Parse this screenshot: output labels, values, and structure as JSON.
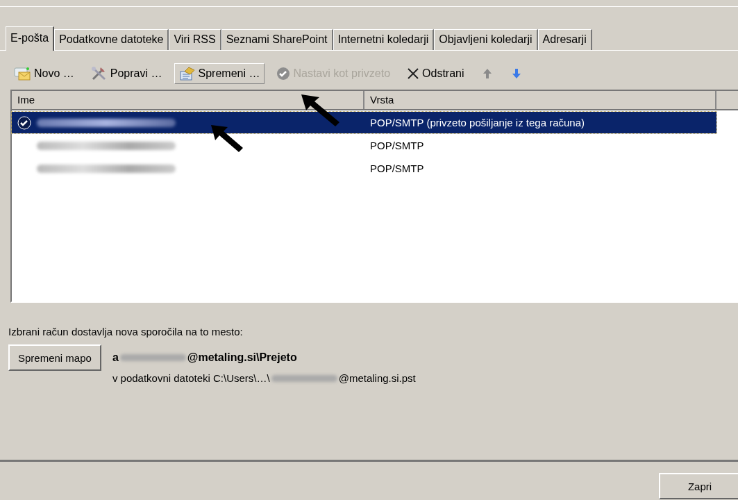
{
  "tabs": [
    {
      "label": "E-pošta",
      "selected": true
    },
    {
      "label": "Podatkovne datoteke",
      "selected": false
    },
    {
      "label": "Viri RSS",
      "selected": false
    },
    {
      "label": "Seznami SharePoint",
      "selected": false
    },
    {
      "label": "Internetni koledarji",
      "selected": false
    },
    {
      "label": "Objavljeni koledarji",
      "selected": false
    },
    {
      "label": "Adresarji",
      "selected": false
    }
  ],
  "toolbar": [
    {
      "kind": "new",
      "label": "Novo …",
      "disabled": false,
      "hovered": false
    },
    {
      "kind": "repair",
      "label": "Popravi …",
      "disabled": false,
      "hovered": false
    },
    {
      "kind": "change",
      "label": "Spremeni …",
      "disabled": false,
      "hovered": true
    },
    {
      "kind": "default",
      "label": "Nastavi kot privzeto",
      "disabled": true,
      "hovered": false
    },
    {
      "kind": "remove",
      "label": "Odstrani",
      "disabled": false,
      "hovered": false
    },
    {
      "kind": "up",
      "disabled": true,
      "hovered": false
    },
    {
      "kind": "down",
      "disabled": false,
      "hovered": false
    }
  ],
  "accounts": {
    "columns": [
      "Ime",
      "Vrsta"
    ],
    "rows": [
      {
        "type": "POP/SMTP (privzeto pošiljanje iz tega računa)",
        "default": true,
        "selected": true
      },
      {
        "type": "POP/SMTP",
        "default": false,
        "selected": false
      },
      {
        "type": "POP/SMTP",
        "default": false,
        "selected": false
      }
    ]
  },
  "delivery": {
    "label": "Izbrani račun dostavlja nova sporočila na to mesto:",
    "button": "Spremeni mapo",
    "folder_prefix": "a",
    "folder_suffix": "@metaling.si\\Prejeto",
    "file_prefix": "v podatkovni datoteki C:\\Users\\…\\",
    "file_suffix": "@metaling.si.pst"
  },
  "close_button": "Zapri"
}
